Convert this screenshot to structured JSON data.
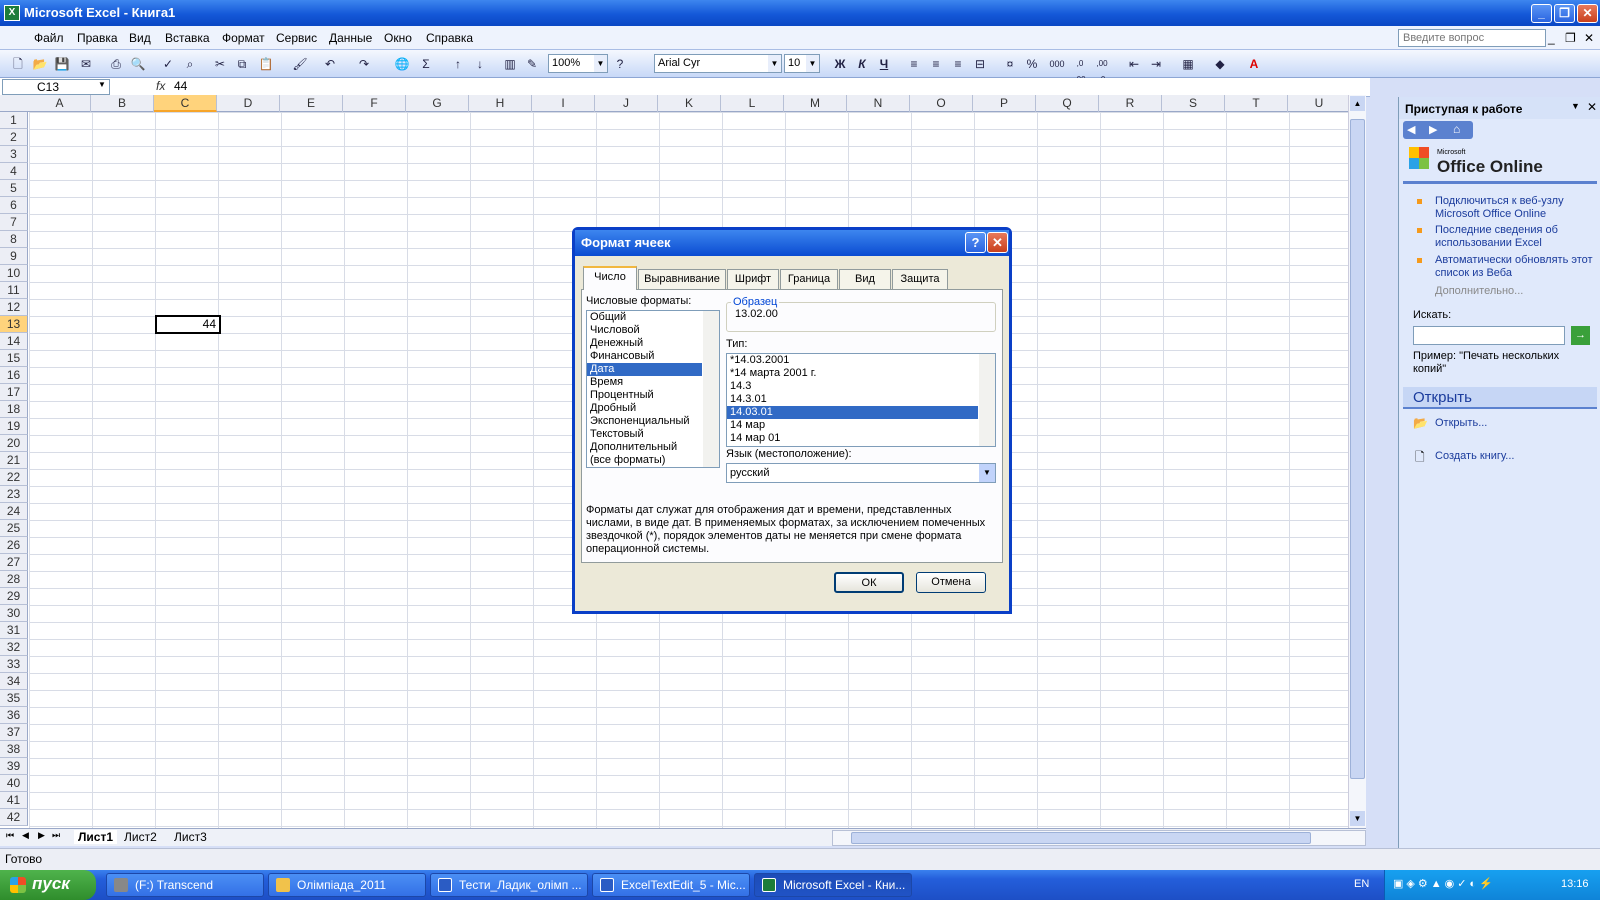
{
  "window": {
    "title": "Microsoft Excel - Книга1",
    "min_glyph": "_",
    "max_glyph": "❐",
    "close_glyph": "✕"
  },
  "menu": {
    "items": [
      "Файл",
      "Правка",
      "Вид",
      "Вставка",
      "Формат",
      "Сервис",
      "Данные",
      "Окно",
      "Справка"
    ],
    "help_placeholder": "Введите вопрос"
  },
  "toolbar": {
    "zoom": "100%",
    "font": "Arial Cyr",
    "size": "10",
    "bold": "Ж",
    "italic": "К",
    "underline": "Ч",
    "percent": "%",
    "thousands": "000",
    "inc_dec": ",0 ,00",
    "dec_dec": ",00 ,0"
  },
  "formula": {
    "namebox": "C13",
    "fx": "fx",
    "value": "44"
  },
  "grid": {
    "columns": [
      "A",
      "B",
      "C",
      "D",
      "E",
      "F",
      "G",
      "H",
      "I",
      "J",
      "K",
      "L",
      "M",
      "N",
      "O",
      "P",
      "Q",
      "R",
      "S",
      "T",
      "U"
    ],
    "rows": [
      "1",
      "2",
      "3",
      "4",
      "5",
      "6",
      "7",
      "8",
      "9",
      "10",
      "11",
      "12",
      "13",
      "14",
      "15",
      "16",
      "17",
      "18",
      "19",
      "20",
      "21",
      "22",
      "23",
      "24",
      "25",
      "26",
      "27",
      "28",
      "29",
      "30",
      "31",
      "32",
      "33",
      "34",
      "35",
      "36",
      "37",
      "38",
      "39",
      "40",
      "41",
      "42"
    ],
    "active_value": "44",
    "active_col": "C",
    "active_row": "13"
  },
  "sheets": [
    "Лист1",
    "Лист2",
    "Лист3"
  ],
  "taskpane": {
    "title": "Приступая к работе",
    "logo_small": "Microsoft",
    "logo_big": "Office Online",
    "links": [
      "Подключиться к веб-узлу Microsoft Office Online",
      "Последние сведения об использовании Excel",
      "Автоматически обновлять этот список из Веба"
    ],
    "more": "Дополнительно...",
    "search_label": "Искать:",
    "example": "Пример: \"Печать нескольких копий\"",
    "open_header": "Открыть",
    "open_link": "Открыть...",
    "new_link": "Создать книгу..."
  },
  "status": {
    "text": "Готово"
  },
  "taskbar": {
    "start": "пуск",
    "buttons": [
      "(F:) Transcend",
      "Олімпіада_2011",
      "Тести_Ладик_олімп ...",
      "ExcelTextEdit_5 - Mic...",
      "Microsoft Excel - Кни..."
    ],
    "lang": "EN",
    "time": "13:16"
  },
  "dialog": {
    "title": "Формат ячеек",
    "help_glyph": "?",
    "close_glyph": "✕",
    "tabs": [
      "Число",
      "Выравнивание",
      "Шрифт",
      "Граница",
      "Вид",
      "Защита"
    ],
    "formats_label": "Числовые форматы:",
    "formats": [
      "Общий",
      "Числовой",
      "Денежный",
      "Финансовый",
      "Дата",
      "Время",
      "Процентный",
      "Дробный",
      "Экспоненциальный",
      "Текстовый",
      "Дополнительный",
      "(все форматы)"
    ],
    "formats_selected": "Дата",
    "sample_label": "Образец",
    "sample_value": "13.02.00",
    "type_label": "Тип:",
    "types": [
      "*14.03.2001",
      "*14 марта 2001 г.",
      "14.3",
      "14.3.01",
      "14.03.01",
      "14 мар",
      "14 мар 01"
    ],
    "types_selected": "14.03.01",
    "lang_label": "Язык (местоположение):",
    "lang_value": "русский",
    "description": "Форматы дат служат для отображения дат и времени, представленных числами, в виде дат. В применяемых форматах, за исключением помеченных звездочкой (*), порядок элементов даты не меняется при смене формата операционной системы.",
    "ok": "ОК",
    "cancel": "Отмена"
  }
}
